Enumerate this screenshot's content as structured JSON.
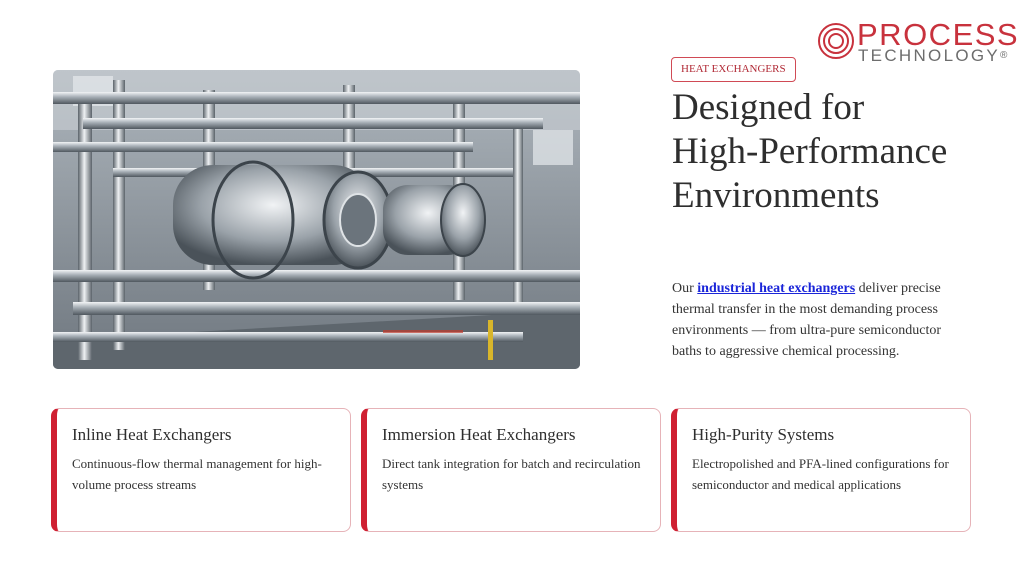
{
  "brand": {
    "name_line1": "PROCESS",
    "name_line2": "TECHNOLOGY",
    "trademark": "®"
  },
  "tag": "HEAT EXCHANGERS",
  "heading": {
    "line1": "Designed for",
    "line2": "High-Performance",
    "line3": "Environments"
  },
  "description": {
    "prefix": "Our ",
    "link_text": "industrial heat exchangers",
    "suffix": " deliver precise thermal transfer in the most demanding process environments — from ultra-pure semiconductor baths to aggressive chemical processing."
  },
  "cards": [
    {
      "title": "Inline Heat Exchangers",
      "body": "Continuous-flow thermal management for high-volume process streams"
    },
    {
      "title": "Immersion Heat Exchangers",
      "body": "Direct tank integration for batch and recirculation systems"
    },
    {
      "title": "High-Purity Systems",
      "body": "Electropolished and PFA-lined configurations for semiconductor and medical applications"
    }
  ],
  "colors": {
    "accent": "#cf2032",
    "link": "#1a25d9",
    "card_border": "#e6b3b8"
  }
}
